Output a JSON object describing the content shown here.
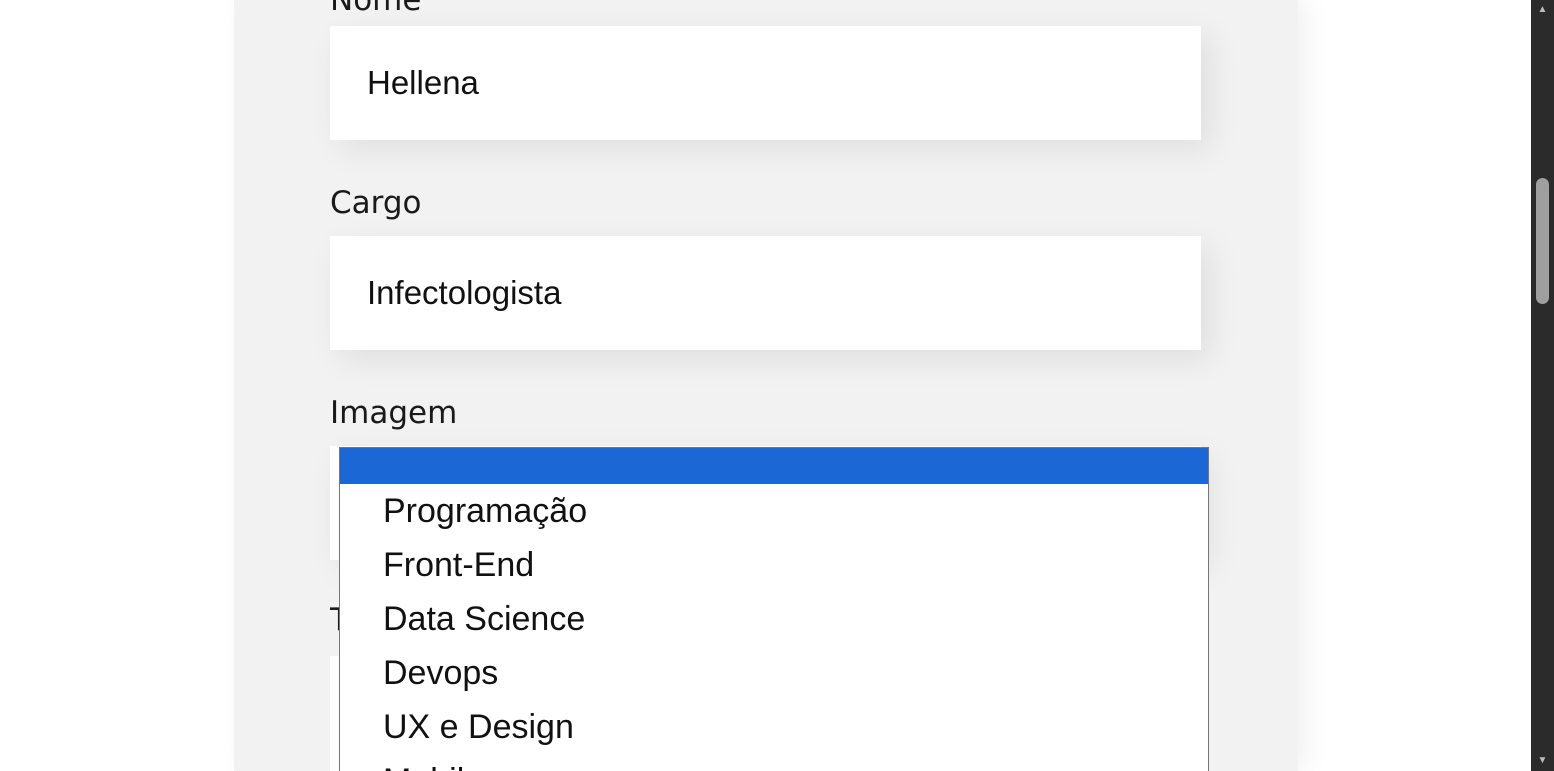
{
  "form": {
    "nome": {
      "label": "Nome",
      "value": "Hellena"
    },
    "cargo": {
      "label": "Cargo",
      "value": "Infectologista"
    },
    "imagem": {
      "label": "Imagem"
    },
    "time": {
      "label": "Time",
      "dropdown": {
        "selected": "",
        "options": [
          "",
          "Programação",
          "Front-End",
          "Data Science",
          "Devops",
          "UX e Design",
          "Mobile"
        ]
      }
    }
  },
  "colors": {
    "panel_background": "#f2f2f2",
    "input_background": "#ffffff",
    "selected_option": "#1b67d6",
    "scrollbar_track": "#2b2b2b",
    "scrollbar_thumb": "#9f9f9f"
  },
  "icons": {
    "scroll_up": "triangle-up-icon",
    "scroll_down": "triangle-down-icon"
  }
}
